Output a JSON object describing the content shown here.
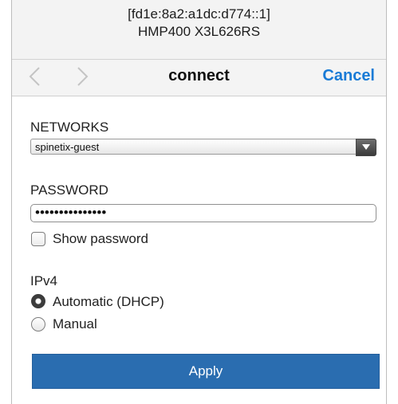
{
  "header": {
    "host_address": "[fd1e:8a2:a1dc:d774::1]",
    "device_model": "HMP400 X3L626RS"
  },
  "navbar": {
    "title": "connect",
    "cancel_label": "Cancel",
    "back_icon": "chevron-left-icon",
    "forward_icon": "chevron-right-icon",
    "accent_color": "#1a7bd6"
  },
  "networks": {
    "label": "NETWORKS",
    "selected_value": "spinetix-guest"
  },
  "password": {
    "label": "PASSWORD",
    "masked_value": "•••••••••••••••",
    "show_password_label": "Show password",
    "show_password_checked": false
  },
  "ipv4": {
    "label": "IPv4",
    "options": [
      {
        "label": "Automatic (DHCP)",
        "selected": true
      },
      {
        "label": "Manual",
        "selected": false
      }
    ]
  },
  "apply_label": "Apply",
  "apply_color": "#2a6db0"
}
